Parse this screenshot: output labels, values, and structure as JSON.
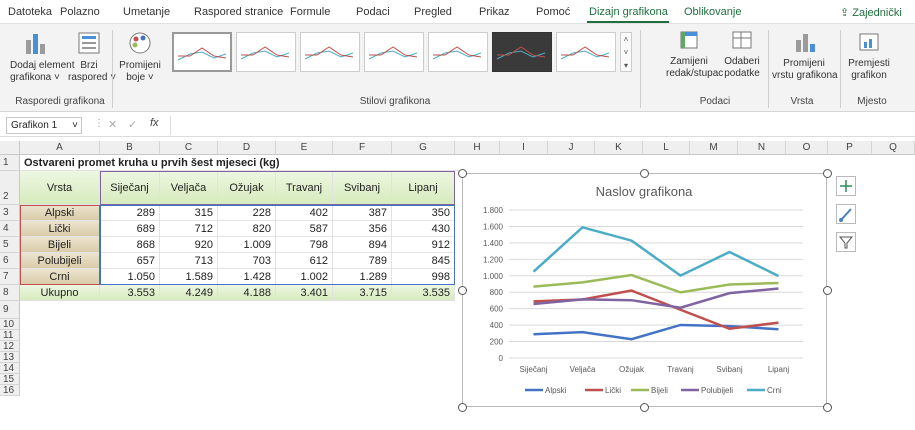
{
  "tabs": [
    "Datoteka",
    "Polazno",
    "Umetanje",
    "Raspored stranice",
    "Formule",
    "Podaci",
    "Pregled",
    "Prikaz",
    "Pomoć",
    "Dizajn grafikona",
    "Oblikovanje"
  ],
  "share_label": "Zajednički",
  "ribbon": {
    "add_element": [
      "Dodaj element",
      "grafikona ˅"
    ],
    "quick_layout": [
      "Brzi",
      "raspored ˅"
    ],
    "change_colors": [
      "Promijeni",
      "boje ˅"
    ],
    "switch_row_col": [
      "Zamijeni",
      "redak/stupac"
    ],
    "select_data": [
      "Odaberi",
      "podatke"
    ],
    "change_type": [
      "Promijeni",
      "vrstu grafikona"
    ],
    "move_chart": [
      "Premjesti",
      "grafikon"
    ],
    "groups": [
      "Rasporedi grafikona",
      "Stilovi grafikona",
      "Podaci",
      "Vrsta",
      "Mjesto"
    ],
    "styles_count": 8
  },
  "formula_bar": {
    "name_box": "Grafikon 1",
    "fx": "fx",
    "value": ""
  },
  "columns": [
    "A",
    "B",
    "C",
    "D",
    "E",
    "F",
    "G",
    "H",
    "I",
    "J",
    "K",
    "L",
    "M",
    "N",
    "O",
    "P",
    "Q"
  ],
  "rows": [
    "1",
    "2",
    "3",
    "4",
    "5",
    "6",
    "7",
    "8",
    "9",
    "10",
    "11",
    "12",
    "13",
    "14",
    "15",
    "16"
  ],
  "table": {
    "title": "Ostvareni promet kruha u prvih šest mjeseci (kg)",
    "header_label": "Vrsta",
    "months": [
      "Siječanj",
      "Veljača",
      "Ožujak",
      "Travanj",
      "Svibanj",
      "Lipanj"
    ],
    "rows": [
      {
        "label": "Alpski",
        "values": [
          "289",
          "315",
          "228",
          "402",
          "387",
          "350"
        ]
      },
      {
        "label": "Lički",
        "values": [
          "689",
          "712",
          "820",
          "587",
          "356",
          "430"
        ]
      },
      {
        "label": "Bijeli",
        "values": [
          "868",
          "920",
          "1.009",
          "798",
          "894",
          "912"
        ]
      },
      {
        "label": "Polubijeli",
        "values": [
          "657",
          "713",
          "703",
          "612",
          "789",
          "845"
        ]
      },
      {
        "label": "Crni",
        "values": [
          "1.050",
          "1.589",
          "1.428",
          "1.002",
          "1.289",
          "998"
        ]
      }
    ],
    "total_label": "Ukupno",
    "totals": [
      "3.553",
      "4.249",
      "4.188",
      "3.401",
      "3.715",
      "3.535"
    ]
  },
  "chart_data": {
    "type": "line",
    "title": "Naslov grafikona",
    "categories": [
      "Siječanj",
      "Veljača",
      "Ožujak",
      "Travanj",
      "Svibanj",
      "Lipanj"
    ],
    "series": [
      {
        "name": "Alpski",
        "values": [
          289,
          315,
          228,
          402,
          387,
          350
        ],
        "color": "#4472c4"
      },
      {
        "name": "Lički",
        "values": [
          689,
          712,
          820,
          587,
          356,
          430
        ],
        "color": "#c0504d"
      },
      {
        "name": "Bijeli",
        "values": [
          868,
          920,
          1009,
          798,
          894,
          912
        ],
        "color": "#9bbb59"
      },
      {
        "name": "Polubijeli",
        "values": [
          657,
          713,
          703,
          612,
          789,
          845
        ],
        "color": "#8064a2"
      },
      {
        "name": "Crni",
        "values": [
          1050,
          1589,
          1428,
          1002,
          1289,
          998
        ],
        "color": "#4bacc6"
      }
    ],
    "ylim": [
      0,
      1800
    ],
    "yticks": [
      "0",
      "200",
      "400",
      "600",
      "800",
      "1.000",
      "1.200",
      "1.400",
      "1.600",
      "1.800"
    ],
    "grid": true,
    "legend": "bottom"
  },
  "colors": {
    "accent": "#1e6f3c",
    "header_fill": "#d6ebbd",
    "label_fill": "#d9cca8"
  },
  "icons": [
    "plus-icon",
    "brush-icon",
    "filter-icon"
  ]
}
